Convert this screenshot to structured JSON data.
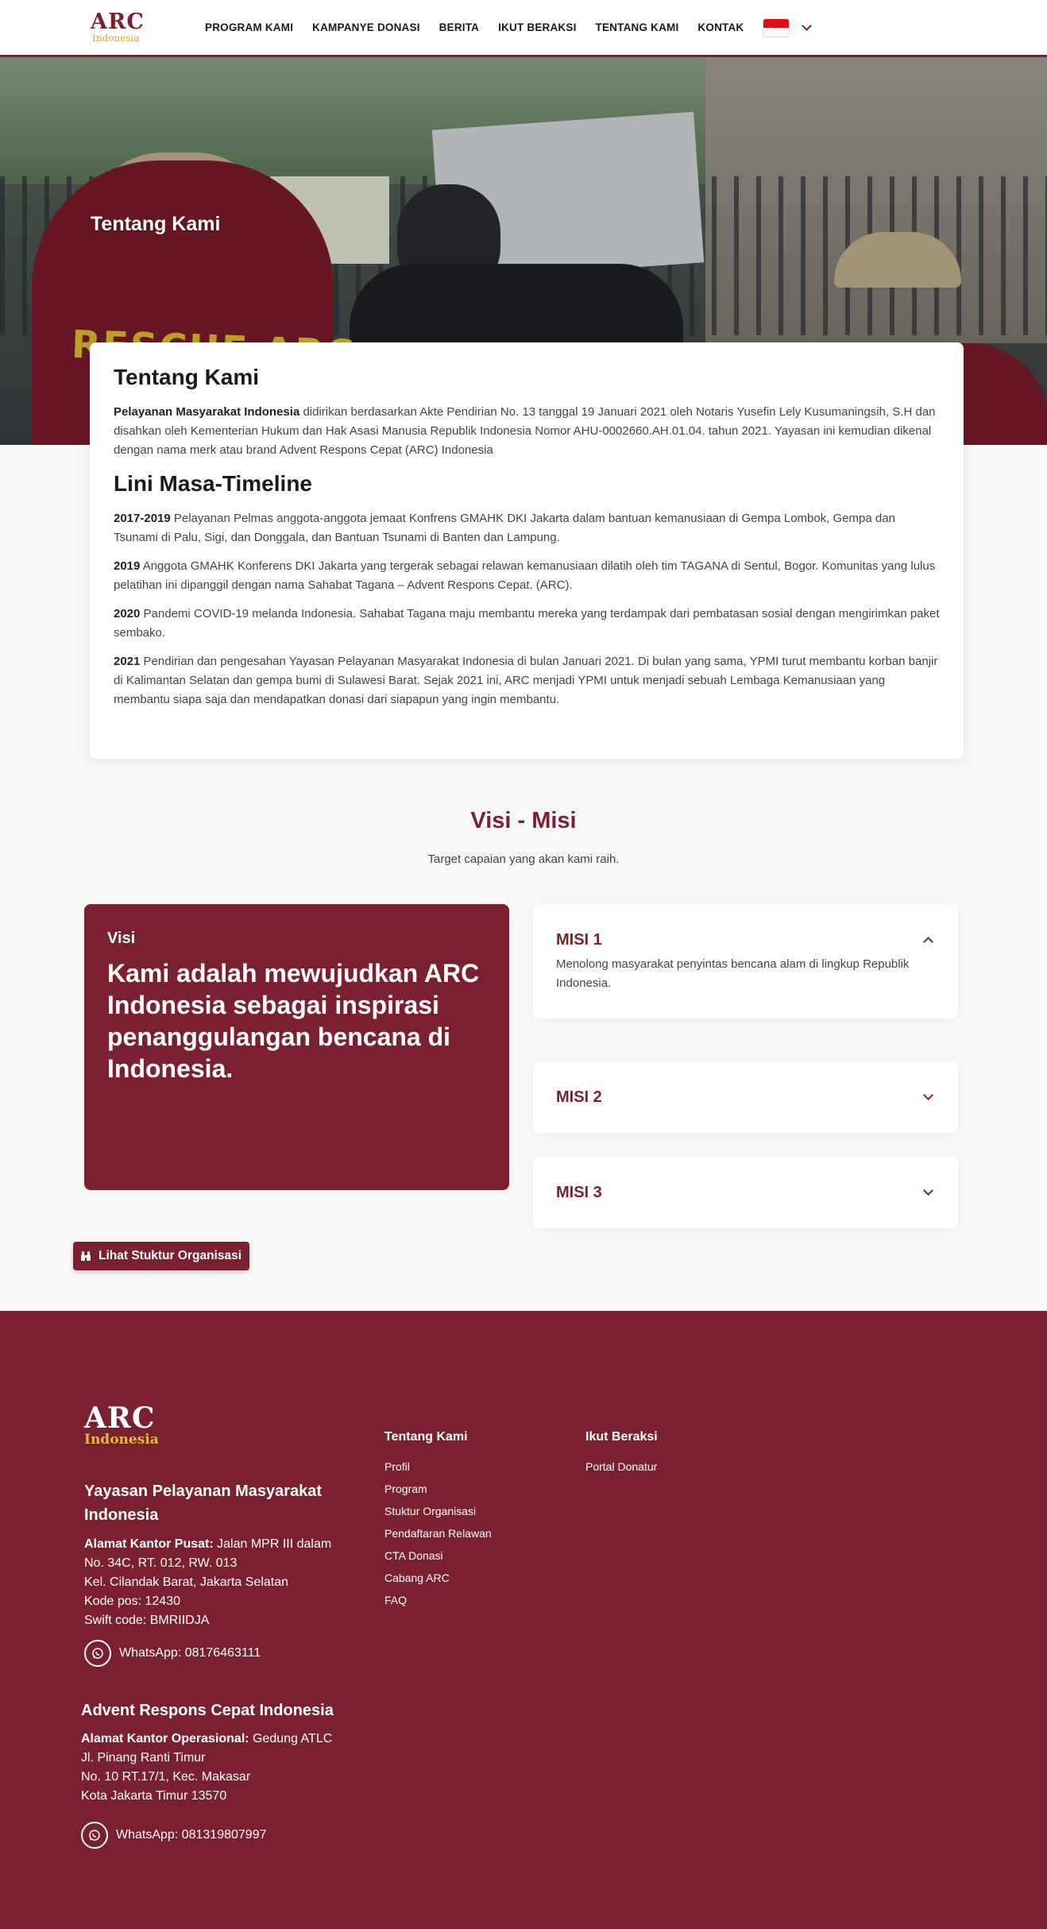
{
  "brand": {
    "logo_main": "ARC",
    "logo_sub": "Indonesia",
    "accent": "#7b2031",
    "gold": "#e0a92a"
  },
  "nav": {
    "items": [
      "PROGRAM KAMI",
      "KAMPANYE DONASI",
      "BERITA",
      "IKUT BERAKSI",
      "TENTANG KAMI",
      "KONTAK"
    ],
    "language_flag": "flag-indonesia-icon"
  },
  "hero": {
    "title": "Tentang Kami",
    "shirt_text": "RESCUE ARC"
  },
  "about": {
    "title": "Tentang Kami",
    "intro_bold": "Pelayanan Masyarakat Indonesia",
    "intro_rest": " didirikan berdasarkan Akte Pendirian No. 13 tanggal 19 Januari 2021 oleh Notaris Yusefin Lely Kusumaningsih, S.H dan disahkan oleh Kementerian Hukum dan Hak Asasi Manusia Republik Indonesia Nomor AHU-0002660.AH.01.04. tahun 2021. Yayasan ini kemudian dikenal dengan nama merk atau brand Advent Respons Cepat (ARC) Indonesia",
    "timeline_title": "Lini Masa-Timeline",
    "timeline": [
      {
        "year": "2017-2019",
        "text": " Pelayanan Pelmas anggota-anggota jemaat Konfrens GMAHK DKI Jakarta dalam bantuan kemanusiaan di Gempa Lombok, Gempa dan Tsunami di Palu, Sigi, dan Donggala, dan Bantuan Tsunami di Banten dan Lampung."
      },
      {
        "year": "2019",
        "text": " Anggota GMAHK Konferens DKI Jakarta yang tergerak sebagai relawan kemanusiaan dilatih oleh tim TAGANA di Sentul, Bogor. Komunitas yang lulus pelatihan ini dipanggil dengan nama Sahabat Tagana – Advent Respons Cepat. (ARC)."
      },
      {
        "year": "2020",
        "text": " Pandemi COVID-19 melanda Indonesia. Sahabat Tagana maju membantu mereka yang terdampak dari pembatasan sosial dengan mengirimkan paket sembako."
      },
      {
        "year": "2021",
        "text": " Pendirian dan pengesahan Yayasan Pelayanan Masyarakat Indonesia di bulan Januari 2021. Di bulan yang sama, YPMI turut membantu korban banjir di Kalimantan Selatan dan gempa bumi di Sulawesi Barat. Sejak 2021 ini, ARC menjadi YPMI untuk menjadi sebuah Lembaga Kemanusiaan yang membantu siapa saja dan mendapatkan donasi dari siapapun yang ingin membantu."
      }
    ]
  },
  "visi_misi": {
    "title": "Visi - Misi",
    "subtitle": "Target capaian yang akan kami raih.",
    "visi_label": "Visi",
    "visi_text": "Kami adalah mewujudkan ARC Indonesia sebagai inspirasi penanggulangan bencana di Indonesia.",
    "misi": [
      {
        "title": "MISI 1",
        "expanded": true,
        "body": "Menolong masyarakat penyintas bencana alam di lingkup Republik Indonesia."
      },
      {
        "title": "MISI 2",
        "expanded": false
      },
      {
        "title": "MISI 3",
        "expanded": false
      }
    ],
    "struct_button": "Lihat Stuktur Organisasi"
  },
  "footer": {
    "logo_main": "ARC",
    "logo_sub": "Indonesia",
    "org1": {
      "name": "Yayasan Pelayanan Masyarakat Indonesia",
      "addr_label": "Alamat Kantor Pusat:",
      "addr_line1": " Jalan MPR III dalam",
      "addr_line2": "No. 34C, RT. 012, RW. 013",
      "addr_line3": "Kel. Cilandak Barat, Jakarta Selatan",
      "addr_line4": "Kode pos: 12430",
      "addr_line5": "Swift code: BMRIIDJA",
      "whatsapp": "WhatsApp: 08176463111"
    },
    "org2": {
      "name": "Advent Respons Cepat Indonesia",
      "addr_label": "Alamat Kantor Operasional:",
      "addr_line1": " Gedung ATLC",
      "addr_line2": "Jl. Pinang Ranti Timur",
      "addr_line3": "No. 10 RT.17/1, Kec. Makasar",
      "addr_line4": "Kota Jakarta Timur 13570",
      "whatsapp": "WhatsApp: 081319807997"
    },
    "col1": {
      "title": "Tentang Kami",
      "links": [
        "Profil",
        "Program",
        "Stuktur Organisasi",
        "Pendaftaran Relawan",
        "CTA Donasi",
        "Cabang ARC",
        "FAQ"
      ]
    },
    "col2": {
      "title": "Ikut Beraksi",
      "links": [
        "Portal Donatur"
      ]
    }
  }
}
